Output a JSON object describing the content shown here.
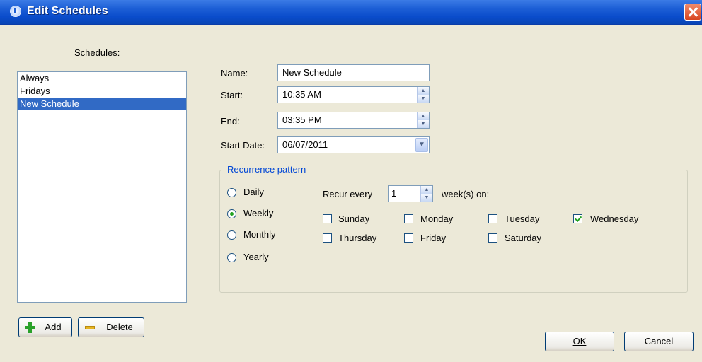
{
  "window": {
    "title": "Edit Schedules"
  },
  "schedules": {
    "label": "Schedules:",
    "items": [
      {
        "label": "Always",
        "selected": false
      },
      {
        "label": "Fridays",
        "selected": false
      },
      {
        "label": "New Schedule",
        "selected": true
      }
    ]
  },
  "form": {
    "name_label": "Name:",
    "name_value": "New Schedule",
    "start_label": "Start:",
    "start_value": "10:35 AM",
    "end_label": "End:",
    "end_value": "03:35 PM",
    "start_date_label": "Start Date:",
    "start_date_value": "06/07/2011"
  },
  "recurrence": {
    "legend": "Recurrence pattern",
    "options": [
      {
        "label": "Daily",
        "checked": false
      },
      {
        "label": "Weekly",
        "checked": true
      },
      {
        "label": "Monthly",
        "checked": false
      },
      {
        "label": "Yearly",
        "checked": false
      }
    ],
    "recur_every_label": "Recur every",
    "recur_every_value": "1",
    "weeks_on_label": "week(s) on:",
    "days": [
      {
        "label": "Sunday",
        "checked": false
      },
      {
        "label": "Monday",
        "checked": false
      },
      {
        "label": "Tuesday",
        "checked": false
      },
      {
        "label": "Wednesday",
        "checked": true
      },
      {
        "label": "Thursday",
        "checked": false
      },
      {
        "label": "Friday",
        "checked": false
      },
      {
        "label": "Saturday",
        "checked": false
      }
    ]
  },
  "buttons": {
    "add": "Add",
    "delete": "Delete",
    "ok": "OK",
    "cancel": "Cancel"
  }
}
